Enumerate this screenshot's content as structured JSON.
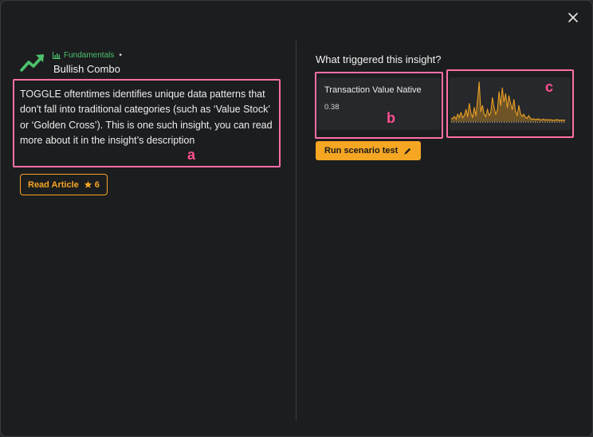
{
  "modal": {
    "close_icon": "close-icon"
  },
  "insight": {
    "icon": "trending-up-icon",
    "category_icon": "bar-chart-icon",
    "category": "Fundamentals",
    "category_dot": "•",
    "title": "Bullish Combo",
    "description": "TOGGLE oftentimes identifies unique data patterns that don't fall into traditional categories (such as ‘Value Stock’ or ‘Golden Cross’). This is one such insight, you can read more about it in the insight’s description",
    "read_article_label": "Read Article",
    "star_icon": "star-icon",
    "star_count": "6"
  },
  "trigger": {
    "heading": "What triggered this insight?",
    "metric_label": "Transaction Value Native",
    "metric_value": "0.38",
    "run_label": "Run scenario test",
    "run_icon": "pencil-icon"
  },
  "annotations": {
    "a": "a",
    "b": "b",
    "c": "c"
  },
  "colors": {
    "accent": "#f5a623",
    "positive": "#4cc26c",
    "annotation": "#ff4f8f"
  },
  "chart_data": {
    "type": "line",
    "series": [
      {
        "values": [
          0.05,
          0.08,
          0.12,
          0.06,
          0.18,
          0.1,
          0.22,
          0.09,
          0.15,
          0.3,
          0.12,
          0.45,
          0.2,
          0.1,
          0.35,
          0.14,
          0.55,
          1.0,
          0.25,
          0.4,
          0.18,
          0.12,
          0.3,
          0.15,
          0.22,
          0.6,
          0.35,
          0.18,
          0.28,
          0.75,
          0.4,
          0.85,
          0.5,
          0.7,
          0.35,
          0.65,
          0.45,
          0.3,
          0.55,
          0.25,
          0.15,
          0.4,
          0.2,
          0.12,
          0.18,
          0.1,
          0.08,
          0.14,
          0.07,
          0.05,
          0.06,
          0.04,
          0.05,
          0.06,
          0.03,
          0.04,
          0.05,
          0.03,
          0.04,
          0.03,
          0.04,
          0.03,
          0.02,
          0.03,
          0.04,
          0.03,
          0.02,
          0.03,
          0.02,
          0.03
        ]
      }
    ],
    "grid": false,
    "legend": false
  }
}
